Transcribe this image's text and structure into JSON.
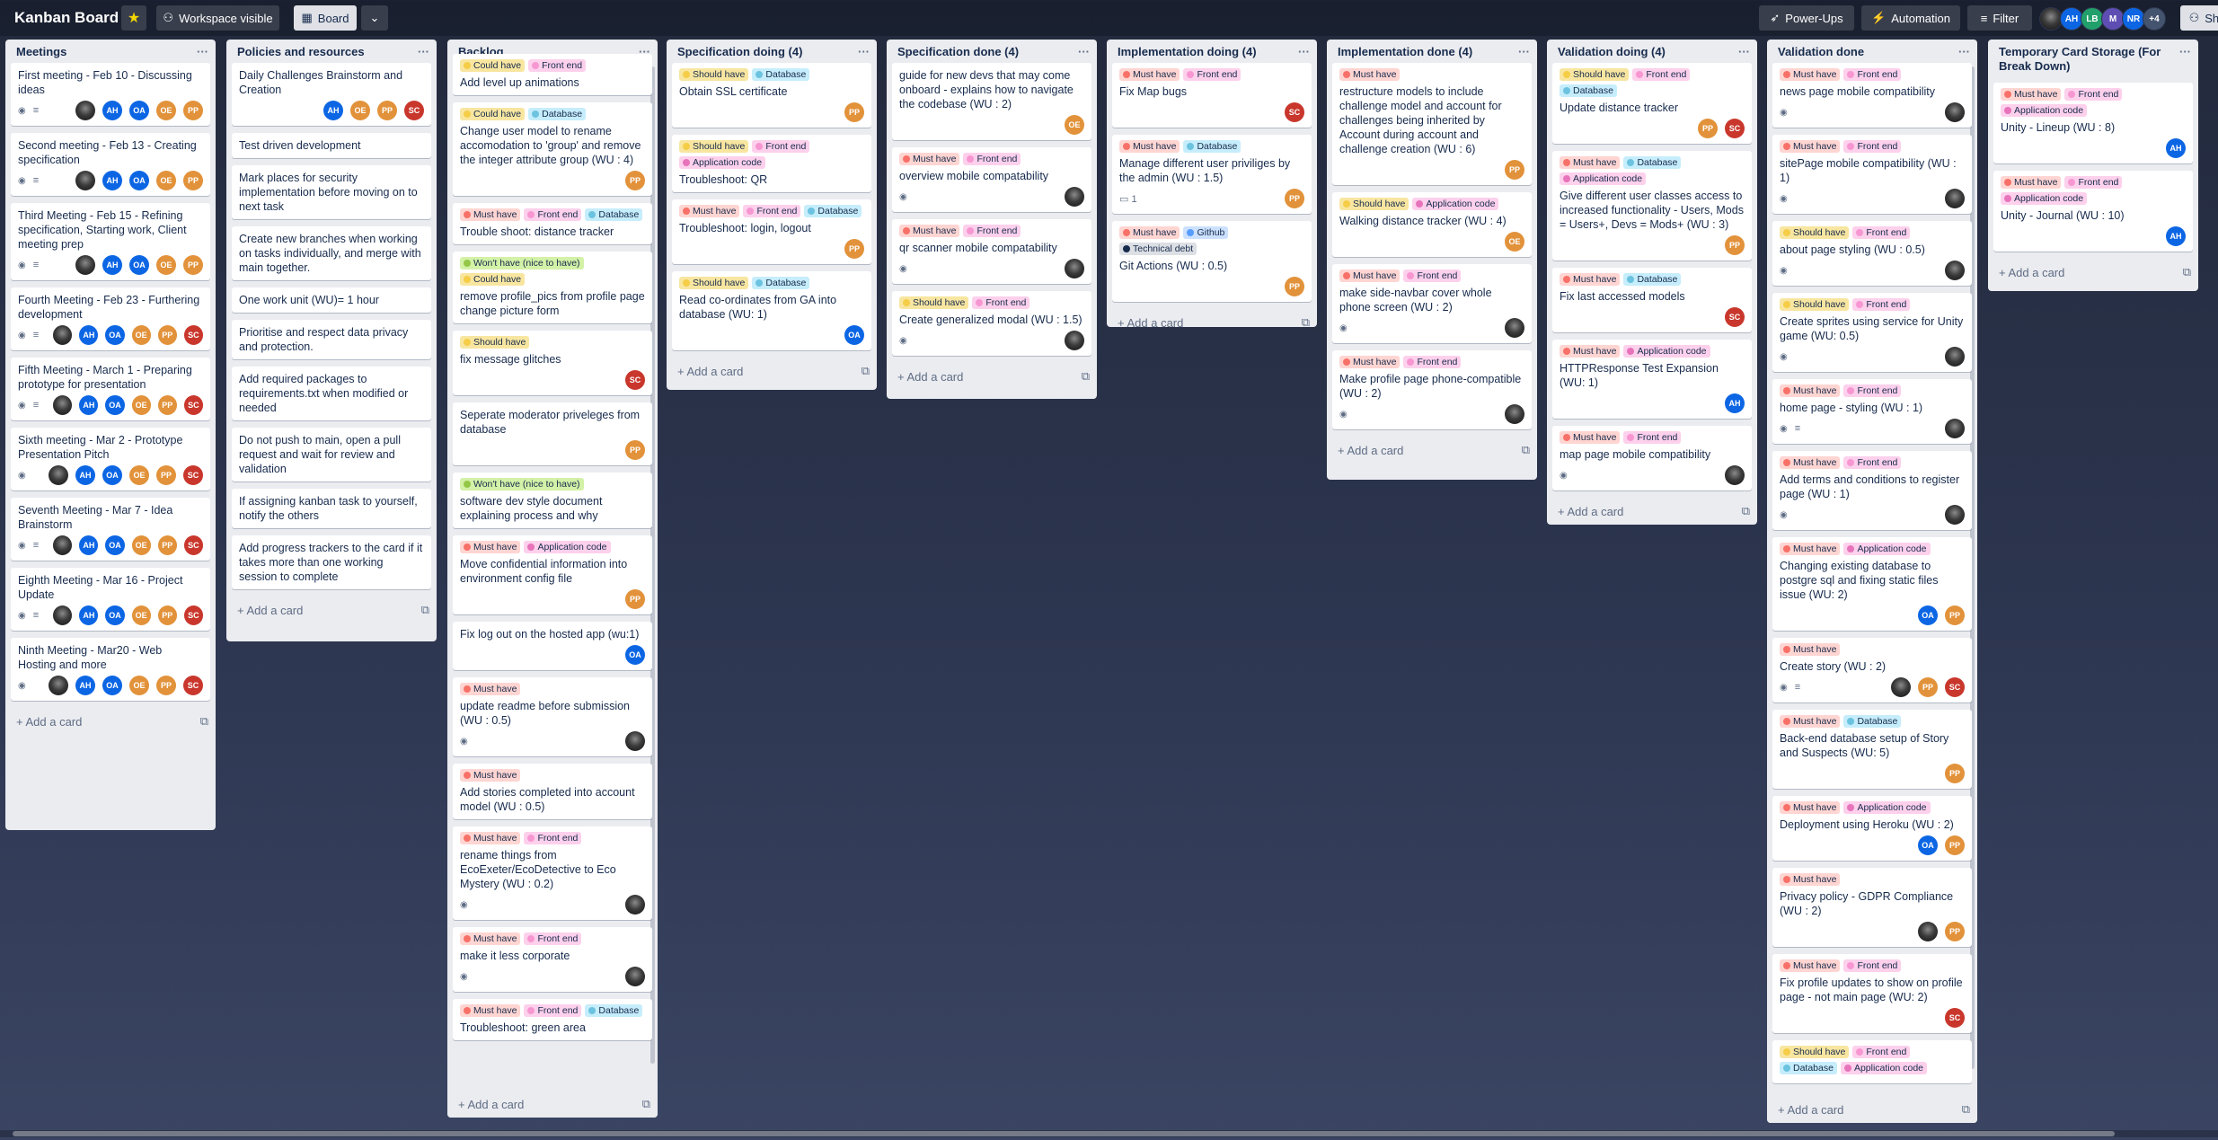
{
  "topbar": {
    "title": "Kanban Board",
    "star_icon": "star-icon",
    "visibility": "Workspace visible",
    "view": "Board",
    "powerups": "Power-Ups",
    "automation": "Automation",
    "filter": "Filter",
    "share": "Sha",
    "members": [
      {
        "initials": "",
        "color": "#444"
      },
      {
        "initials": "AH",
        "color": "#0c66e4"
      },
      {
        "initials": "LB",
        "color": "#22a06b"
      },
      {
        "initials": "M",
        "color": "#5e4db2"
      },
      {
        "initials": "NR",
        "color": "#0c66e4"
      },
      {
        "initials": "+4",
        "color": "#44546f"
      }
    ]
  },
  "colors": {
    "must_have": "#f87168",
    "should_have": "#f5cd47",
    "could_have": "#f5cd47",
    "wont_have": "#94c748",
    "front_end": "#f797d2",
    "database": "#6cc3e0",
    "application_code": "#e774bb",
    "github": "#579dff",
    "technical_debt": "#172b4d",
    "OA": "#0c66e4",
    "AH": "#0c66e4",
    "OE": "#e2923a",
    "PP": "#e2923a",
    "SC": "#c9372c"
  },
  "add_card_label": "Add a card",
  "lists": [
    {
      "title": "Meetings",
      "cards": [
        {
          "title": "First meeting - Feb 10 - Discussing ideas",
          "labels": [],
          "badges": [
            "eye",
            "desc"
          ],
          "members": [
            "photo",
            "AH",
            "OA",
            "OE",
            "PP"
          ]
        },
        {
          "title": "Second meeting - Feb 13 - Creating specification",
          "labels": [],
          "badges": [
            "eye",
            "desc"
          ],
          "members": [
            "photo",
            "AH",
            "OA",
            "OE",
            "PP"
          ]
        },
        {
          "title": "Third Meeting - Feb 15 - Refining specification, Starting work, Client meeting prep",
          "labels": [],
          "badges": [
            "eye",
            "desc"
          ],
          "members": [
            "photo",
            "AH",
            "OA",
            "OE",
            "PP"
          ]
        },
        {
          "title": "Fourth Meeting - Feb 23 - Furthering development",
          "labels": [],
          "badges": [
            "eye",
            "desc"
          ],
          "members": [
            "photo",
            "AH",
            "OA",
            "OE",
            "PP",
            "SC"
          ]
        },
        {
          "title": "Fifth Meeting - March 1 - Preparing prototype for presentation",
          "labels": [],
          "badges": [
            "eye",
            "desc"
          ],
          "members": [
            "photo",
            "AH",
            "OA",
            "OE",
            "PP",
            "SC"
          ]
        },
        {
          "title": "Sixth meeting - Mar 2 - Prototype Presentation Pitch",
          "labels": [],
          "badges": [
            "eye"
          ],
          "members": [
            "photo",
            "AH",
            "OA",
            "OE",
            "PP",
            "SC"
          ]
        },
        {
          "title": "Seventh Meeting - Mar 7 - Idea Brainstorm",
          "labels": [],
          "badges": [
            "eye",
            "desc"
          ],
          "members": [
            "photo",
            "AH",
            "OA",
            "OE",
            "PP",
            "SC"
          ]
        },
        {
          "title": "Eighth Meeting - Mar 16 - Project Update",
          "labels": [],
          "badges": [
            "eye",
            "desc"
          ],
          "members": [
            "photo",
            "AH",
            "OA",
            "OE",
            "PP",
            "SC"
          ]
        },
        {
          "title": "Ninth Meeting - Mar20 - Web Hosting and more",
          "labels": [],
          "badges": [
            "eye"
          ],
          "members": [
            "photo",
            "AH",
            "OA",
            "OE",
            "PP",
            "SC"
          ]
        }
      ]
    },
    {
      "title": "Policies and resources",
      "cards": [
        {
          "title": "Daily Challenges Brainstorm and Creation",
          "labels": [],
          "badges": [],
          "members": [
            "AH",
            "OE",
            "PP",
            "SC"
          ]
        },
        {
          "title": "Test driven development",
          "labels": [],
          "badges": [],
          "members": []
        },
        {
          "title": "Mark places for security implementation before moving on to next task",
          "labels": [],
          "badges": [],
          "members": []
        },
        {
          "title": "Create new branches when working on tasks individually, and merge with main together.",
          "labels": [],
          "badges": [],
          "members": []
        },
        {
          "title": "One work unit (WU)= 1 hour",
          "labels": [],
          "badges": [],
          "members": []
        },
        {
          "title": "Prioritise and respect data privacy and protection.",
          "labels": [],
          "badges": [],
          "members": []
        },
        {
          "title": "Add required packages to requirements.txt when modified or needed",
          "labels": [],
          "badges": [],
          "members": []
        },
        {
          "title": "Do not push to main, open a pull request and wait for review and validation",
          "labels": [],
          "badges": [],
          "members": []
        },
        {
          "title": "If assigning kanban task to yourself, notify the others",
          "labels": [],
          "badges": [],
          "members": []
        },
        {
          "title": "Add progress trackers to the card if it takes more than one working session to complete",
          "labels": [],
          "badges": [],
          "members": []
        }
      ]
    },
    {
      "title": "Backlog",
      "cards": [
        {
          "title": "Add level up animations",
          "labels": [
            "Could have",
            "Front end"
          ],
          "badges": [],
          "members": []
        },
        {
          "title": "Change user model to rename accomodation to 'group' and remove the integer attribute group (WU : 4)",
          "labels": [
            "Could have",
            "Database"
          ],
          "badges": [],
          "members": [
            "PP"
          ]
        },
        {
          "title": "Trouble shoot: distance tracker",
          "labels": [
            "Must have",
            "Front end",
            "Database"
          ],
          "badges": [],
          "members": []
        },
        {
          "title": "remove profile_pics from profile page change picture form",
          "labels": [
            "Won't have (nice to have)",
            "Could have"
          ],
          "badges": [],
          "members": []
        },
        {
          "title": "fix message glitches",
          "labels": [
            "Should have"
          ],
          "badges": [],
          "members": [
            "SC"
          ]
        },
        {
          "title": "Seperate moderator priveleges from database",
          "labels": [],
          "badges": [],
          "members": [
            "PP"
          ]
        },
        {
          "title": "software dev style document explaining process and why",
          "labels": [
            "Won't have (nice to have)"
          ],
          "badges": [],
          "members": []
        },
        {
          "title": "Move confidential information into environment config file",
          "labels": [
            "Must have",
            "Application code"
          ],
          "badges": [],
          "members": [
            "PP"
          ]
        },
        {
          "title": "Fix log out on the hosted app (wu:1)",
          "labels": [],
          "badges": [],
          "members": [
            "OA"
          ]
        },
        {
          "title": "update readme before submission (WU : 0.5)",
          "labels": [
            "Must have"
          ],
          "badges": [
            "eye"
          ],
          "members": [
            "photo"
          ]
        },
        {
          "title": "Add stories completed into account model (WU : 0.5)",
          "labels": [
            "Must have"
          ],
          "badges": [],
          "members": []
        },
        {
          "title": "rename things from EcoExeter/EcoDetective to Eco Mystery (WU : 0.2)",
          "labels": [
            "Must have",
            "Front end"
          ],
          "badges": [
            "eye"
          ],
          "members": [
            "photo"
          ]
        },
        {
          "title": "make it less corporate",
          "labels": [
            "Must have",
            "Front end"
          ],
          "badges": [
            "eye"
          ],
          "members": [
            "photo"
          ]
        },
        {
          "title": "Troubleshoot: green area",
          "labels": [
            "Must have",
            "Front end",
            "Database"
          ],
          "badges": [],
          "members": []
        }
      ]
    },
    {
      "title": "Specification doing (4)",
      "cards": [
        {
          "title": "Obtain SSL certificate",
          "labels": [
            "Should have",
            "Database"
          ],
          "badges": [],
          "members": [
            "PP"
          ]
        },
        {
          "title": "Troubleshoot: QR",
          "labels": [
            "Should have",
            "Front end",
            "Application code"
          ],
          "badges": [],
          "members": []
        },
        {
          "title": "Troubleshoot: login, logout",
          "labels": [
            "Must have",
            "Front end",
            "Database"
          ],
          "badges": [],
          "members": [
            "PP"
          ]
        },
        {
          "title": "Read co-ordinates from GA into database (WU: 1)",
          "labels": [
            "Should have",
            "Database"
          ],
          "badges": [],
          "members": [
            "OA"
          ]
        }
      ]
    },
    {
      "title": "Specification done (4)",
      "cards": [
        {
          "title": "guide for new devs that may come onboard - explains how to navigate the codebase (WU : 2)",
          "labels": [],
          "badges": [],
          "members": [
            "OE"
          ]
        },
        {
          "title": "overview mobile compatability",
          "labels": [
            "Must have",
            "Front end"
          ],
          "badges": [
            "eye"
          ],
          "members": [
            "photo"
          ]
        },
        {
          "title": "qr scanner mobile compatability",
          "labels": [
            "Must have",
            "Front end"
          ],
          "badges": [
            "eye"
          ],
          "members": [
            "photo"
          ]
        },
        {
          "title": "Create generalized modal (WU : 1.5)",
          "labels": [
            "Should have",
            "Front end"
          ],
          "badges": [
            "eye"
          ],
          "members": [
            "photo"
          ]
        }
      ]
    },
    {
      "title": "Implementation doing (4)",
      "cards": [
        {
          "title": "Fix Map bugs",
          "labels": [
            "Must have",
            "Front end"
          ],
          "badges": [],
          "members": [
            "SC"
          ]
        },
        {
          "title": "Manage different user priviliges by the admin (WU : 1.5)",
          "labels": [
            "Must have",
            "Database"
          ],
          "badges": [
            "comment:1"
          ],
          "members": [
            "PP"
          ]
        },
        {
          "title": "Git Actions (WU : 0.5)",
          "labels": [
            "Must have",
            "Github",
            "Technical debt"
          ],
          "badges": [],
          "members": [
            "PP"
          ]
        }
      ]
    },
    {
      "title": "Implementation done (4)",
      "cards": [
        {
          "title": "restructure models to include challenge model and account for challenges being inherited by Account during account and challenge creation (WU : 6)",
          "labels": [
            "Must have"
          ],
          "badges": [],
          "members": [
            "PP"
          ]
        },
        {
          "title": "Walking distance tracker (WU : 4)",
          "labels": [
            "Should have",
            "Application code"
          ],
          "badges": [],
          "members": [
            "OE"
          ]
        },
        {
          "title": "make side-navbar cover whole phone screen (WU : 2)",
          "labels": [
            "Must have",
            "Front end"
          ],
          "badges": [
            "eye"
          ],
          "members": [
            "photo"
          ]
        },
        {
          "title": "Make profile page phone-compatible (WU : 2)",
          "labels": [
            "Must have",
            "Front end"
          ],
          "badges": [
            "eye"
          ],
          "members": [
            "photo"
          ]
        }
      ]
    },
    {
      "title": "Validation doing (4)",
      "cards": [
        {
          "title": "Update distance tracker",
          "labels": [
            "Should have",
            "Front end",
            "Database"
          ],
          "badges": [],
          "members": [
            "PP",
            "SC"
          ]
        },
        {
          "title": "Give different user classes access to increased functionality - Users, Mods = Users+, Devs = Mods+ (WU : 3)",
          "labels": [
            "Must have",
            "Database",
            "Application code"
          ],
          "badges": [],
          "members": [
            "PP"
          ]
        },
        {
          "title": "Fix last accessed models",
          "labels": [
            "Must have",
            "Database"
          ],
          "badges": [],
          "members": [
            "SC"
          ]
        },
        {
          "title": "HTTPResponse Test Expansion (WU: 1)",
          "labels": [
            "Must have",
            "Application code"
          ],
          "badges": [],
          "members": [
            "AH"
          ]
        },
        {
          "title": "map page mobile compatibility",
          "labels": [
            "Must have",
            "Front end"
          ],
          "badges": [
            "eye"
          ],
          "members": [
            "photo"
          ]
        }
      ]
    },
    {
      "title": "Validation done",
      "cards": [
        {
          "title": "news page mobile compatibility",
          "labels": [
            "Must have",
            "Front end"
          ],
          "badges": [
            "eye"
          ],
          "members": [
            "photo"
          ]
        },
        {
          "title": "sitePage mobile compatibility (WU : 1)",
          "labels": [
            "Must have",
            "Front end"
          ],
          "badges": [
            "eye"
          ],
          "members": [
            "photo"
          ]
        },
        {
          "title": "about page styling (WU : 0.5)",
          "labels": [
            "Should have",
            "Front end"
          ],
          "badges": [
            "eye"
          ],
          "members": [
            "photo"
          ]
        },
        {
          "title": "Create sprites using service for Unity game (WU: 0.5)",
          "labels": [
            "Should have",
            "Front end"
          ],
          "badges": [
            "eye"
          ],
          "members": [
            "photo"
          ]
        },
        {
          "title": "home page - styling (WU : 1)",
          "labels": [
            "Must have",
            "Front end"
          ],
          "badges": [
            "eye",
            "desc"
          ],
          "members": [
            "photo"
          ]
        },
        {
          "title": "Add terms and conditions to register page (WU : 1)",
          "labels": [
            "Must have",
            "Front end"
          ],
          "badges": [
            "eye"
          ],
          "members": [
            "photo"
          ]
        },
        {
          "title": "Changing existing database to postgre sql and fixing static files issue (WU: 2)",
          "labels": [
            "Must have",
            "Application code"
          ],
          "badges": [],
          "members": [
            "OA",
            "PP"
          ]
        },
        {
          "title": "Create story (WU : 2)",
          "labels": [
            "Must have"
          ],
          "badges": [
            "eye",
            "desc"
          ],
          "members": [
            "photo",
            "PP",
            "SC"
          ]
        },
        {
          "title": "Back-end database setup of Story and Suspects (WU: 5)",
          "labels": [
            "Must have",
            "Database"
          ],
          "badges": [],
          "members": [
            "PP"
          ]
        },
        {
          "title": "Deployment using Heroku (WU : 2)",
          "labels": [
            "Must have",
            "Application code"
          ],
          "badges": [],
          "members": [
            "OA",
            "PP"
          ]
        },
        {
          "title": "Privacy policy - GDPR Compliance (WU : 2)",
          "labels": [
            "Must have"
          ],
          "badges": [],
          "members": [
            "photo",
            "PP"
          ]
        },
        {
          "title": "Fix profile updates to show on profile page - not main page (WU: 2)",
          "labels": [
            "Must have",
            "Front end"
          ],
          "badges": [],
          "members": [
            "SC"
          ]
        },
        {
          "title": "",
          "labels": [
            "Should have",
            "Front end",
            "Database",
            "Application code"
          ],
          "badges": [],
          "members": []
        }
      ]
    },
    {
      "title": "Temporary Card Storage (For Break Down)",
      "cards": [
        {
          "title": "Unity - Lineup (WU : 8)",
          "labels": [
            "Must have",
            "Front end",
            "Application code"
          ],
          "badges": [],
          "members": [
            "AH"
          ]
        },
        {
          "title": "Unity - Journal (WU : 10)",
          "labels": [
            "Must have",
            "Front end",
            "Application code"
          ],
          "badges": [],
          "members": [
            "AH"
          ]
        }
      ]
    }
  ]
}
